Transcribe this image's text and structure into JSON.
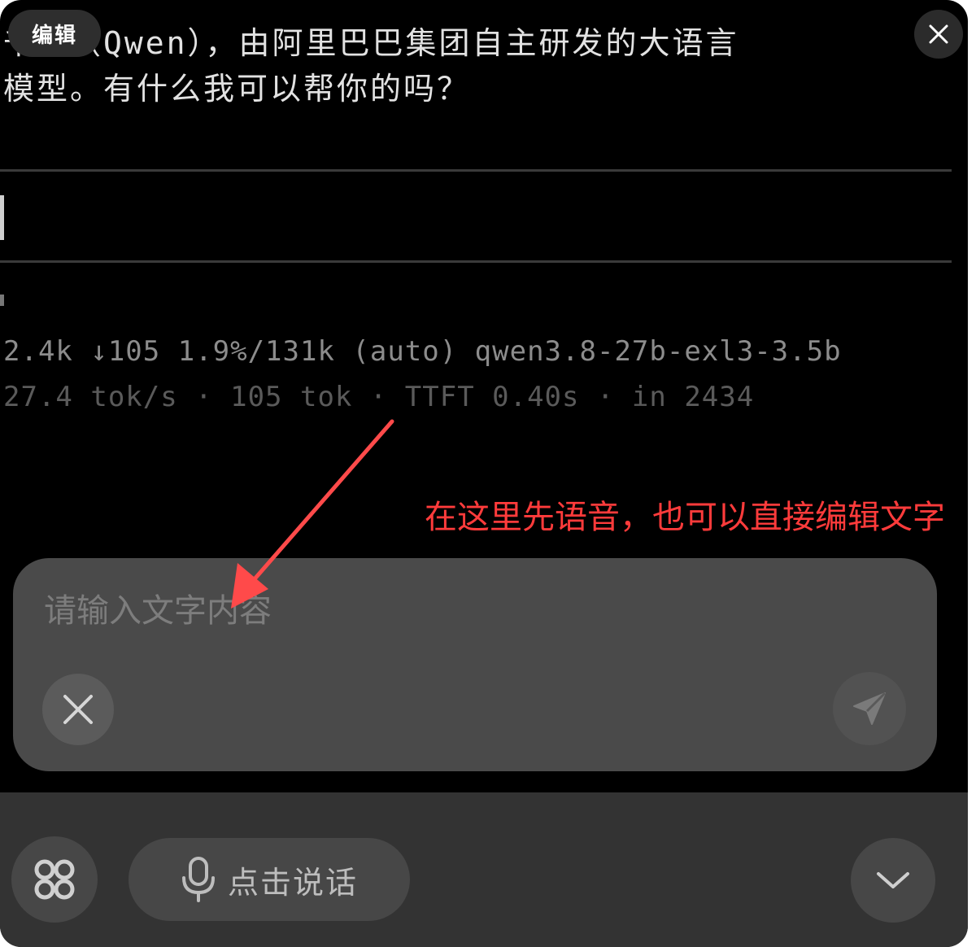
{
  "top": {
    "edit_label": "编辑"
  },
  "terminal": {
    "reply_line_1": "千问（Qwen），由阿里巴巴集团自主研发的大语言",
    "reply_line_2": "模型。有什么我可以帮你的吗？",
    "stats_line_1": "2.4k ↓105 1.9%/131k (auto)  qwen3.8-27b-exl3-3.5b",
    "stats_line_2": "27.4 tok/s · 105 tok · TTFT 0.40s · in 2434"
  },
  "annotation": {
    "text": "在这里先语音，也可以直接编辑文字",
    "color": "#ff3b3b"
  },
  "input": {
    "placeholder": "请输入文字内容",
    "value": ""
  },
  "bottom_bar": {
    "talk_label": "点击说话"
  },
  "icons": {
    "close_top": "close-icon",
    "clear": "close-icon",
    "send": "send-icon",
    "apps": "apps-grid-icon",
    "mic": "microphone-icon",
    "collapse": "chevron-down-icon"
  }
}
